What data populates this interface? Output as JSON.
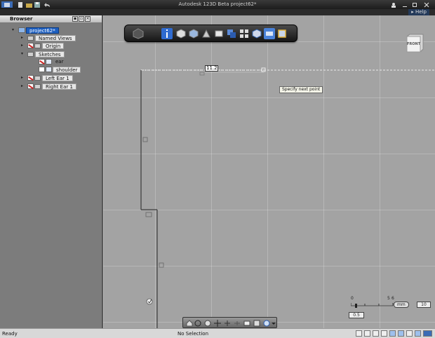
{
  "window": {
    "title": "Autodesk 123D Beta  project62*"
  },
  "help": {
    "label": "Help"
  },
  "browser": {
    "title": "Browser",
    "items": [
      {
        "label": "project62*",
        "selected": true
      },
      {
        "label": "Named Views"
      },
      {
        "label": "Origin"
      },
      {
        "label": "Sketches"
      },
      {
        "label": "ear"
      },
      {
        "label": "shoulder"
      },
      {
        "label": "Left Ear 1"
      },
      {
        "label": "Right Ear 1"
      }
    ]
  },
  "viewport": {
    "viewcube_label": "FRONT",
    "dimension_input": "11.2",
    "tooltip": "Specify next point"
  },
  "zoom": {
    "ticks": [
      "0",
      "5",
      "6"
    ],
    "unit": "mm",
    "max_value": "10",
    "current_value": "0.5"
  },
  "status": {
    "left": "Ready",
    "center": "No Selection"
  },
  "colors": {
    "accent": "#1d5fc0",
    "toolbar_bg": "#161616"
  }
}
